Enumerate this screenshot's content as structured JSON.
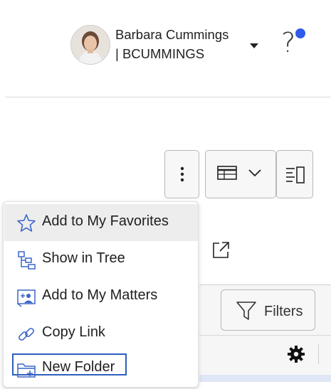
{
  "header": {
    "user_name": "Barbara Cummings",
    "user_id": "| BCUMMINGS",
    "avatar_icon": "user-avatar",
    "dropdown_icon": "caret-down-icon",
    "help_icon": "help-icon",
    "notification_color": "#2e5bea"
  },
  "toolbar": {
    "more_icon": "kebab-menu-icon",
    "view_icon": "table-view-icon",
    "panel_icon": "side-panel-icon"
  },
  "content": {
    "filters_label": "Filters",
    "external_link_icon": "external-link-icon",
    "settings_icon": "gear-icon"
  },
  "menu": {
    "items": [
      {
        "label": "Add to My Favorites",
        "icon": "star-icon"
      },
      {
        "label": "Show in Tree",
        "icon": "tree-icon"
      },
      {
        "label": "Add to My Matters",
        "icon": "add-matter-icon"
      },
      {
        "label": "Copy Link",
        "icon": "link-icon"
      },
      {
        "label": "New Folder",
        "icon": "new-folder-icon"
      }
    ]
  },
  "colors": {
    "accent": "#2f5fbf",
    "icon_blue": "#3a66c8"
  }
}
